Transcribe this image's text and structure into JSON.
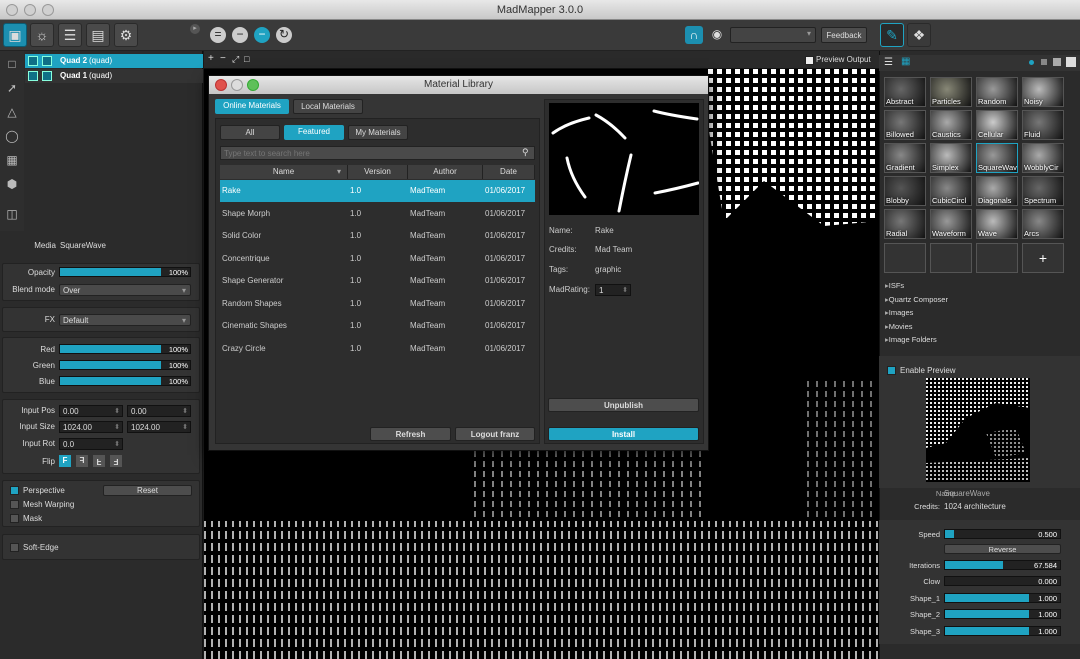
{
  "window": {
    "title": "MadMapper 3.0.0"
  },
  "toolbar": {
    "feedback": "Feedback",
    "preview_output": "Preview Output"
  },
  "quads": [
    {
      "name": "Quad 2",
      "type": "(quad)"
    },
    {
      "name": "Quad 1",
      "type": "(quad)"
    }
  ],
  "props": {
    "media_label": "Media",
    "media_value": "SquareWave",
    "opacity_label": "Opacity",
    "opacity_value": "100%",
    "opacity": 1.0,
    "blend_label": "Blend mode",
    "blend_value": "Over",
    "fx_label": "FX",
    "fx_value": "Default",
    "red_label": "Red",
    "red_value": "100%",
    "green_label": "Green",
    "green_value": "100%",
    "blue_label": "Blue",
    "blue_value": "100%",
    "input_pos_label": "Input Pos",
    "input_pos_x": "0.00",
    "input_pos_y": "0.00",
    "input_size_label": "Input Size",
    "input_size_w": "1024.00",
    "input_size_h": "1024.00",
    "input_rot_label": "Input Rot",
    "input_rot": "0.0",
    "flip_label": "Flip",
    "perspective": "Perspective",
    "reset": "Reset",
    "mesh_warping": "Mesh Warping",
    "mask": "Mask",
    "soft_edge": "Soft-Edge"
  },
  "dialog": {
    "title": "Material Library",
    "tab_online": "Online Materials",
    "tab_local": "Local Materials",
    "filter_all": "All",
    "filter_featured": "Featured",
    "filter_my": "My Materials",
    "search_placeholder": "Type text to search here",
    "col_name": "Name",
    "col_version": "Version",
    "col_author": "Author",
    "col_date": "Date",
    "rows": [
      {
        "name": "Rake",
        "version": "1.0",
        "author": "MadTeam",
        "date": "01/06/2017"
      },
      {
        "name": "Shape Morph",
        "version": "1.0",
        "author": "MadTeam",
        "date": "01/06/2017"
      },
      {
        "name": "Solid Color",
        "version": "1.0",
        "author": "MadTeam",
        "date": "01/06/2017"
      },
      {
        "name": "Concentrique",
        "version": "1.0",
        "author": "MadTeam",
        "date": "01/06/2017"
      },
      {
        "name": "Shape Generator",
        "version": "1.0",
        "author": "MadTeam",
        "date": "01/06/2017"
      },
      {
        "name": "Random Shapes",
        "version": "1.0",
        "author": "MadTeam",
        "date": "01/06/2017"
      },
      {
        "name": "Cinematic Shapes",
        "version": "1.0",
        "author": "MadTeam",
        "date": "01/06/2017"
      },
      {
        "name": "Crazy Circle",
        "version": "1.0",
        "author": "MadTeam",
        "date": "01/06/2017"
      }
    ],
    "refresh": "Refresh",
    "logout": "Logout franz",
    "detail": {
      "name_label": "Name:",
      "name": "Rake",
      "credits_label": "Credits:",
      "credits": "Mad Team",
      "tags_label": "Tags:",
      "tags": "graphic",
      "rating_label": "MadRating:",
      "rating": "1"
    },
    "unpublish": "Unpublish",
    "install": "Install"
  },
  "library": {
    "tiles": [
      "Abstract",
      "Particles",
      "Random",
      "Noisy",
      "Billowed",
      "Caustics",
      "Cellular",
      "Fluid",
      "Gradient",
      "Simplex",
      "SquareWav",
      "WobblyCir",
      "Blobby",
      "CubicCircl",
      "Diagonals",
      "Spectrum",
      "Radial",
      "Waveform",
      "Wave",
      "Arcs"
    ],
    "add": "+",
    "folders": [
      "ISFs",
      "Quartz Composer",
      "Images",
      "Movies",
      "Image Folders"
    ]
  },
  "preview": {
    "enable": "Enable Preview",
    "name_label": "Name:",
    "name": "SquareWave",
    "credits_label": "Credits:",
    "credits": "1024 architecture"
  },
  "params": [
    {
      "label": "Speed",
      "value": "0.500",
      "level": 0.08
    },
    {
      "label": "Iterations",
      "value": "67.584",
      "level": 0.5
    },
    {
      "label": "Clow",
      "value": "0.000",
      "level": 0.0
    },
    {
      "label": "Shape_1",
      "value": "1.000",
      "level": 0.73
    },
    {
      "label": "Shape_2",
      "value": "1.000",
      "level": 0.73
    },
    {
      "label": "Shape_3",
      "value": "1.000",
      "level": 0.73
    }
  ],
  "reverse": "Reverse",
  "colors": {
    "accent": "#1fa3c2",
    "panel": "#2b2b2b"
  }
}
